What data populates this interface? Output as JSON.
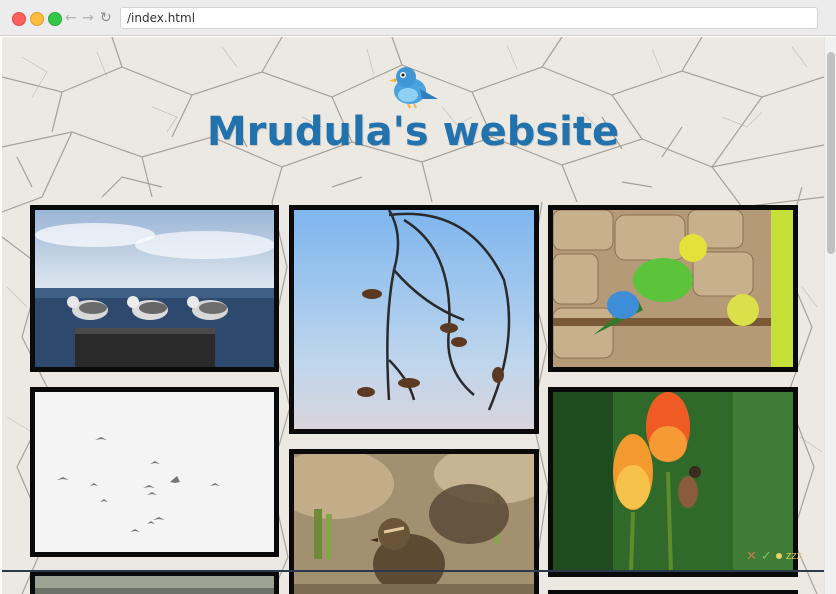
{
  "browser": {
    "url": "/index.html",
    "back_glyph": "←",
    "forward_glyph": "→",
    "reload_glyph": "↻"
  },
  "site": {
    "title": "Mrudula's website",
    "logo_icon": "bird-logo-icon"
  },
  "gallery": {
    "photos": [
      {
        "subject": "seagulls"
      },
      {
        "subject": "birds-on-branch"
      },
      {
        "subject": "parakeets"
      },
      {
        "subject": "flock-in-sky"
      },
      {
        "subject": "ducklings"
      },
      {
        "subject": "bird-on-flower"
      }
    ]
  },
  "overlay": {
    "close_glyph": "✕",
    "check_glyph": "✓",
    "label": "ZZZ"
  },
  "colors": {
    "title": "#2272ad",
    "background": "#ede9e3",
    "frame": "#0a0a0a"
  }
}
